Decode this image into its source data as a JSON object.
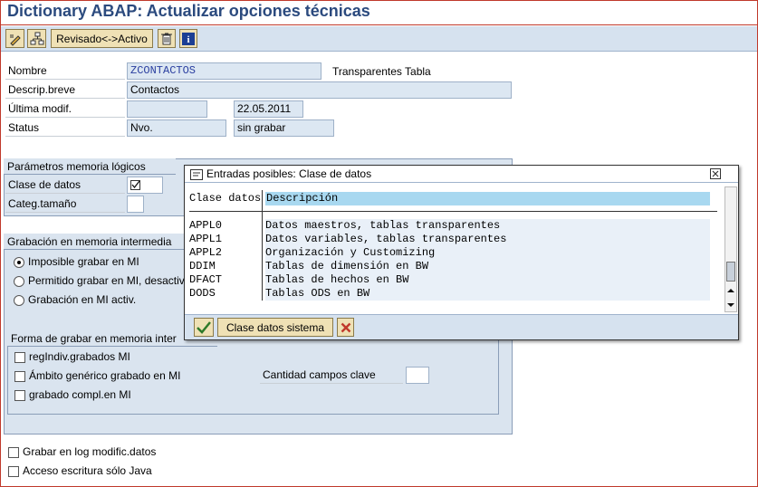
{
  "window": {
    "title": "Dictionary ABAP: Actualizar opciones técnicas"
  },
  "toolbar": {
    "toggle_label": "Revisado<->Activo"
  },
  "form": {
    "nombre_label": "Nombre",
    "nombre_value": "ZCONTACTOS",
    "nombre_type": "Transparentes Tabla",
    "descrip_label": "Descrip.breve",
    "descrip_value": "Contactos",
    "ultima_label": "Última modif.",
    "ultima_user": "",
    "ultima_date": "22.05.2011",
    "status_label": "Status",
    "status_value1": "Nvo.",
    "status_value2": "sin grabar"
  },
  "group_params": {
    "title": "Parámetros memoria lógicos",
    "clase_label": "Clase de datos",
    "clase_value": "",
    "categ_label": "Categ.tamaño",
    "categ_value": ""
  },
  "group_buffer": {
    "title": "Grabación en memoria intermedia",
    "opt1": "Imposible grabar en MI",
    "opt2": "Permitido grabar en MI, desactiv",
    "opt3": "Grabación en MI activ."
  },
  "group_forma": {
    "title": "Forma de grabar en memoria inter",
    "chk1": "regIndiv.grabados MI",
    "chk2": "Ámbito genérico grabado en MI",
    "chk3": "grabado compl.en MI",
    "cantidad_label": "Cantidad campos clave",
    "cantidad_value": ""
  },
  "bottom": {
    "chk_log": "Grabar en log modific.datos",
    "chk_java": "Acceso escritura sólo Java"
  },
  "popup": {
    "title": "Entradas posibles: Clase de datos",
    "col1": "Clase datos",
    "col2": "Descripción",
    "rows": [
      {
        "code": "APPL0",
        "desc": "Datos maestros, tablas transparentes"
      },
      {
        "code": "APPL1",
        "desc": "Datos variables, tablas transparentes"
      },
      {
        "code": "APPL2",
        "desc": "Organización y Customizing"
      },
      {
        "code": "DDIM",
        "desc": "Tablas de dimensión en BW"
      },
      {
        "code": "DFACT",
        "desc": "Tablas de hechos en BW"
      },
      {
        "code": "DODS",
        "desc": "Tablas ODS en BW"
      }
    ],
    "sys_button": "Clase datos sistema"
  },
  "colors": {
    "title": "#2b4a7e",
    "toolbar": "#d6e2ef",
    "field": "#dce7f2",
    "group": "#dae4ef",
    "button": "#efe1b5",
    "accent_red": "#c0392b"
  }
}
